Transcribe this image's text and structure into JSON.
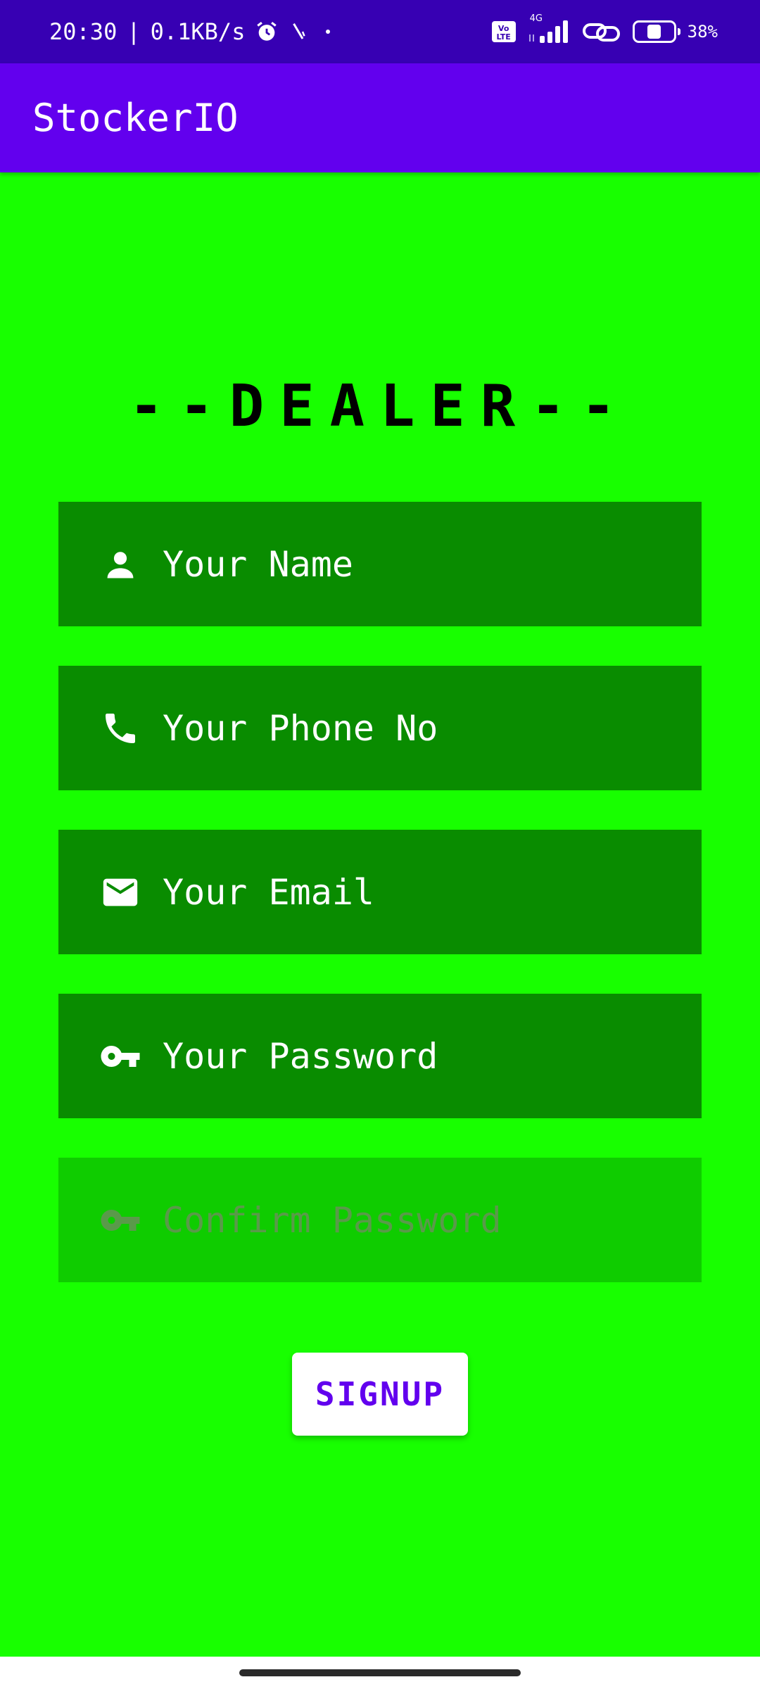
{
  "status_bar": {
    "time": "20:30",
    "separator": "|",
    "network_speed": "0.1KB/s",
    "network_type": "4G",
    "volte": "Vo LTE",
    "battery_percent": "38%",
    "battery_level": 0.38,
    "icons": [
      "alarm-icon",
      "signal-activity-icon",
      "dot-icon",
      "volte-icon",
      "cellular-signal-icon",
      "link-icon",
      "battery-icon"
    ]
  },
  "app_bar": {
    "title": "StockerIO"
  },
  "heading": "--DEALER--",
  "form": {
    "fields": [
      {
        "icon": "person-icon",
        "placeholder": "Your Name",
        "enabled": true
      },
      {
        "icon": "phone-icon",
        "placeholder": "Your Phone No",
        "enabled": true
      },
      {
        "icon": "email-icon",
        "placeholder": "Your Email",
        "enabled": true
      },
      {
        "icon": "key-icon",
        "placeholder": "Your Password",
        "enabled": true
      },
      {
        "icon": "key-icon",
        "placeholder": "Confirm Password",
        "enabled": false
      }
    ],
    "submit_label": "SIGNUP"
  },
  "colors": {
    "status_bar": "#3700b3",
    "app_bar": "#6200ee",
    "background": "#18ff00",
    "field": "#098c00",
    "field_disabled": "#0fcc00",
    "button_text": "#6200ee"
  }
}
